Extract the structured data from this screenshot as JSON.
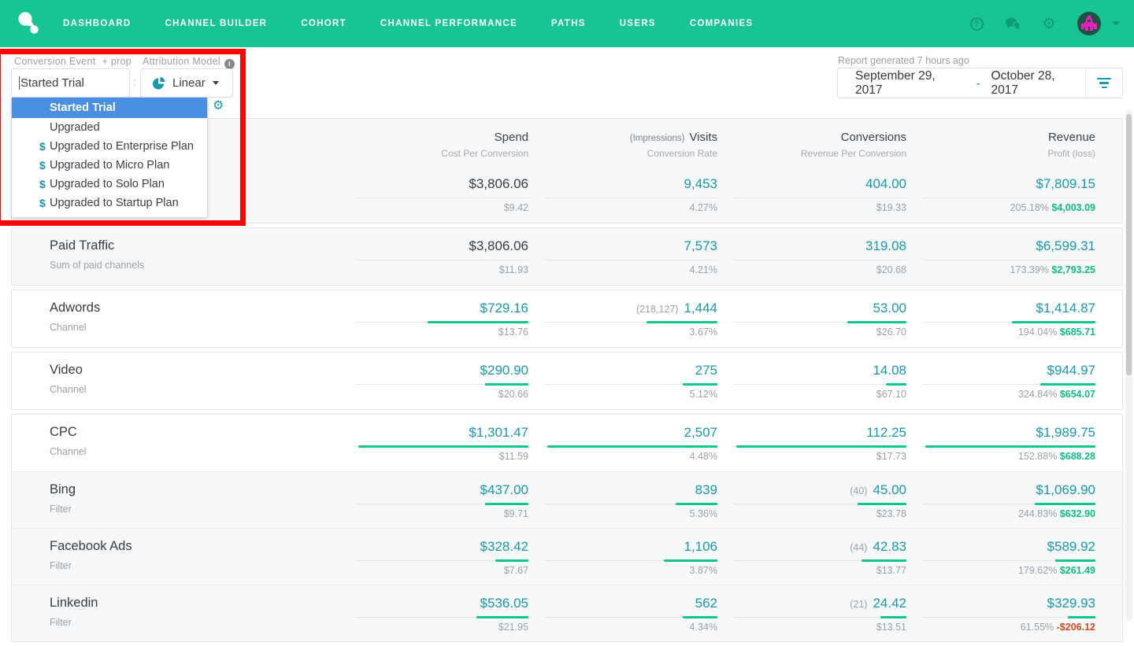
{
  "nav": {
    "items": [
      "DASHBOARD",
      "CHANNEL BUILDER",
      "COHORT",
      "CHANNEL PERFORMANCE",
      "PATHS",
      "USERS",
      "COMPANIES"
    ],
    "right_icons": [
      "help-icon",
      "chat-icon",
      "settings-icon",
      "avatar",
      "avatar-chevron"
    ]
  },
  "filters": {
    "conversion_event": {
      "label": "Conversion Event",
      "prop_label": "+ prop",
      "value": "Started Trial"
    },
    "attribution_model": {
      "label": "Attribution Model",
      "value": "Linear"
    },
    "dropdown_items": [
      {
        "label": "Started Trial",
        "selected": true,
        "revenue": false
      },
      {
        "label": "Upgraded",
        "selected": false,
        "revenue": false
      },
      {
        "label": "Upgraded to Enterprise Plan",
        "selected": false,
        "revenue": true
      },
      {
        "label": "Upgraded to Micro Plan",
        "selected": false,
        "revenue": true
      },
      {
        "label": "Upgraded to Solo Plan",
        "selected": false,
        "revenue": true
      },
      {
        "label": "Upgraded to Startup Plan",
        "selected": false,
        "revenue": true
      }
    ]
  },
  "report": {
    "generated": "Report generated 7 hours ago",
    "date_start": "September 29, 2017",
    "date_separator": "-",
    "date_end": "October 28, 2017"
  },
  "colors": {
    "nav_green": "#17C592",
    "link_teal": "#1799AC",
    "bar_green": "#12C78C",
    "profit_green": "#0EBD81",
    "loss_red": "#D14A1E",
    "selected_blue": "#4A90E2",
    "annotation_red": "#FB0505"
  },
  "table": {
    "columns": [
      {
        "pre": "",
        "top": "Spend",
        "sub": "Cost Per Conversion"
      },
      {
        "pre": "(Impressions)",
        "top": "Visits",
        "sub": "Conversion Rate"
      },
      {
        "pre": "",
        "top": "Conversions",
        "sub": "Revenue Per Conversion"
      },
      {
        "pre": "",
        "top": "Revenue",
        "sub": "Profit (loss)"
      }
    ],
    "cards": [
      {
        "bg": "gray",
        "header": true,
        "rows": [
          {
            "title": "",
            "subtitle": "",
            "chevron": null,
            "shaded": false,
            "cells": [
              {
                "main": "$3,806.06",
                "sub": "$9.42",
                "dark": true,
                "bar": 0
              },
              {
                "main": "9,453",
                "sub": "4.27%",
                "bar": 0
              },
              {
                "main": "404.00",
                "sub": "$19.33",
                "bar": 0
              },
              {
                "main": "$7,809.15",
                "pct": "205.18%",
                "amt": "$4,003.09",
                "amt_color": "green",
                "bar": 0
              }
            ]
          }
        ]
      },
      {
        "bg": "gray",
        "header": false,
        "rows": [
          {
            "title": "Paid Traffic",
            "subtitle": "Sum of paid channels",
            "chevron": null,
            "shaded": false,
            "cells": [
              {
                "main": "$3,806.06",
                "sub": "$11.93",
                "dark": true,
                "bar": 0
              },
              {
                "main": "7,573",
                "sub": "4.21%",
                "bar": 0
              },
              {
                "main": "319.08",
                "sub": "$20.68",
                "bar": 0
              },
              {
                "main": "$6,599.31",
                "pct": "173.39%",
                "amt": "$2,793.25",
                "amt_color": "green",
                "bar": 0
              }
            ]
          }
        ]
      },
      {
        "bg": "white",
        "header": false,
        "rows": [
          {
            "title": "Adwords",
            "subtitle": "Channel",
            "chevron": "right",
            "shaded": false,
            "cells": [
              {
                "main": "$729.16",
                "sub": "$13.76",
                "bar": 0.58
              },
              {
                "pre": "(218,127)",
                "main": "1,444",
                "sub": "3.67%",
                "bar": 0.41
              },
              {
                "main": "53.00",
                "sub": "$26.70",
                "bar": 0.34
              },
              {
                "main": "$1,414.87",
                "pct": "194.04%",
                "amt": "$685.71",
                "amt_color": "green",
                "bar": 0.48
              }
            ]
          }
        ]
      },
      {
        "bg": "white",
        "header": false,
        "rows": [
          {
            "title": "Video",
            "subtitle": "Channel",
            "chevron": "right",
            "shaded": false,
            "cells": [
              {
                "main": "$290.90",
                "sub": "$20.66",
                "bar": 0.25
              },
              {
                "main": "275",
                "sub": "5.12%",
                "bar": 0.2
              },
              {
                "main": "14.08",
                "sub": "$67.10",
                "bar": 0.12
              },
              {
                "main": "$944.97",
                "pct": "324.84%",
                "amt": "$654.07",
                "amt_color": "green",
                "bar": 0.32
              }
            ]
          }
        ]
      },
      {
        "bg": "white",
        "header": false,
        "rows": [
          {
            "title": "CPC",
            "subtitle": "Channel",
            "chevron": "down",
            "shaded": false,
            "cells": [
              {
                "main": "$1,301.47",
                "sub": "$11.59",
                "bar": 0.98
              },
              {
                "main": "2,507",
                "sub": "4.48%",
                "bar": 0.98
              },
              {
                "main": "112.25",
                "sub": "$17.73",
                "bar": 0.98
              },
              {
                "main": "$1,989.75",
                "pct": "152.88%",
                "amt": "$688.28",
                "amt_color": "green",
                "bar": 0.98
              }
            ]
          },
          {
            "title": "Bing",
            "subtitle": "Filter",
            "chevron": null,
            "shaded": true,
            "cells": [
              {
                "main": "$437.00",
                "sub": "$9.71",
                "bar": 0.25
              },
              {
                "main": "839",
                "sub": "5.36%",
                "bar": 0.24
              },
              {
                "pre": "(40)",
                "main": "45.00",
                "sub": "$23.78",
                "bar": 0.28
              },
              {
                "main": "$1,069.90",
                "pct": "244.83%",
                "amt": "$632.90",
                "amt_color": "green",
                "bar": 0.35
              }
            ]
          },
          {
            "title": "Facebook Ads",
            "subtitle": "Filter",
            "chevron": null,
            "shaded": true,
            "cells": [
              {
                "main": "$328.42",
                "sub": "$7.67",
                "bar": 0.19
              },
              {
                "main": "1,106",
                "sub": "3.87%",
                "bar": 0.31
              },
              {
                "pre": "(44)",
                "main": "42.83",
                "sub": "$13.77",
                "bar": 0.26
              },
              {
                "main": "$589.92",
                "pct": "179.62%",
                "amt": "$261.49",
                "amt_color": "green",
                "bar": 0.23
              }
            ]
          },
          {
            "title": "Linkedin",
            "subtitle": "Filter",
            "chevron": null,
            "shaded": true,
            "cells": [
              {
                "main": "$536.05",
                "sub": "$21.95",
                "bar": 0.3
              },
              {
                "main": "562",
                "sub": "4.34%",
                "bar": 0.2
              },
              {
                "pre": "(21)",
                "main": "24.42",
                "sub": "$13.51",
                "bar": 0.15
              },
              {
                "main": "$329.93",
                "pct": "61.55%",
                "amt": "-$206.12",
                "amt_color": "red",
                "bar": 0.16
              }
            ]
          }
        ]
      }
    ]
  }
}
